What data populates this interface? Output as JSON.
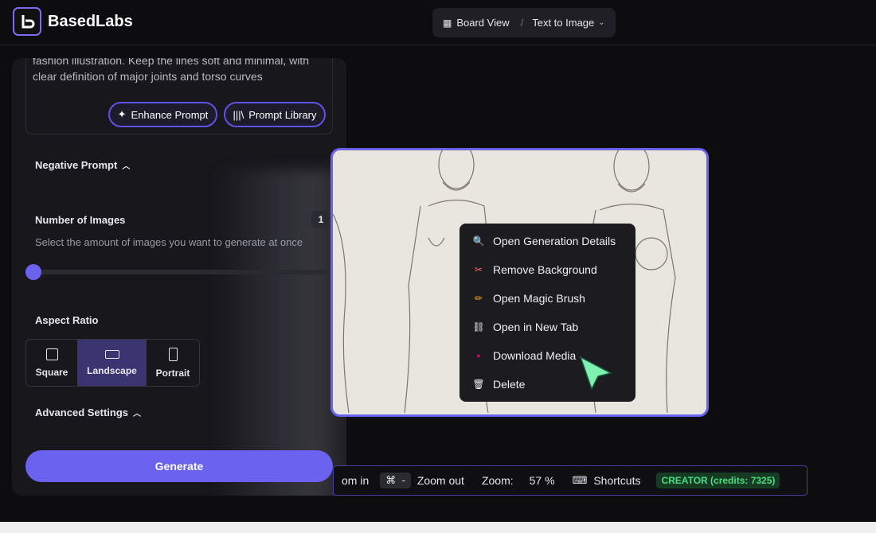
{
  "header": {
    "brand": "BasedLabs",
    "view_label": "Board View",
    "separator": "/",
    "mode_label": "Text to Image"
  },
  "sidebar": {
    "prompt_text": "fashion illustration. Keep the lines soft and minimal, with clear definition of major joints and torso curves",
    "enhance_label": "Enhance Prompt",
    "library_label": "Prompt Library",
    "negative_prompt_label": "Negative Prompt",
    "num_images_label": "Number of Images",
    "num_images_value": "1",
    "num_images_help": "Select the amount of images you want to generate at once",
    "aspect_label": "Aspect Ratio",
    "aspect_options": [
      "Square",
      "Landscape",
      "Portrait"
    ],
    "aspect_selected": "Landscape",
    "advanced_label": "Advanced Settings",
    "generate_label": "Generate"
  },
  "context_menu": {
    "items": [
      {
        "label": "Open Generation Details",
        "icon": "magnifier-icon"
      },
      {
        "label": "Remove Background",
        "icon": "scissors-icon"
      },
      {
        "label": "Open Magic Brush",
        "icon": "pencil-icon"
      },
      {
        "label": "Open in New Tab",
        "icon": "link-icon"
      },
      {
        "label": "Download Media",
        "icon": "floppy-disk-icon"
      },
      {
        "label": "Delete",
        "icon": "trash-icon"
      }
    ]
  },
  "zoom_bar": {
    "zoom_in_label": "om in",
    "cmd_key": "⌘",
    "minus_key": "-",
    "zoom_out_label": "Zoom out",
    "zoom_label": "Zoom:",
    "zoom_value": "57 %",
    "shortcuts_label": "Shortcuts",
    "plan_badge": "CREATOR (credits: 7325)"
  },
  "colors": {
    "accent": "#6b63f0",
    "credit_green": "#4ade80"
  }
}
